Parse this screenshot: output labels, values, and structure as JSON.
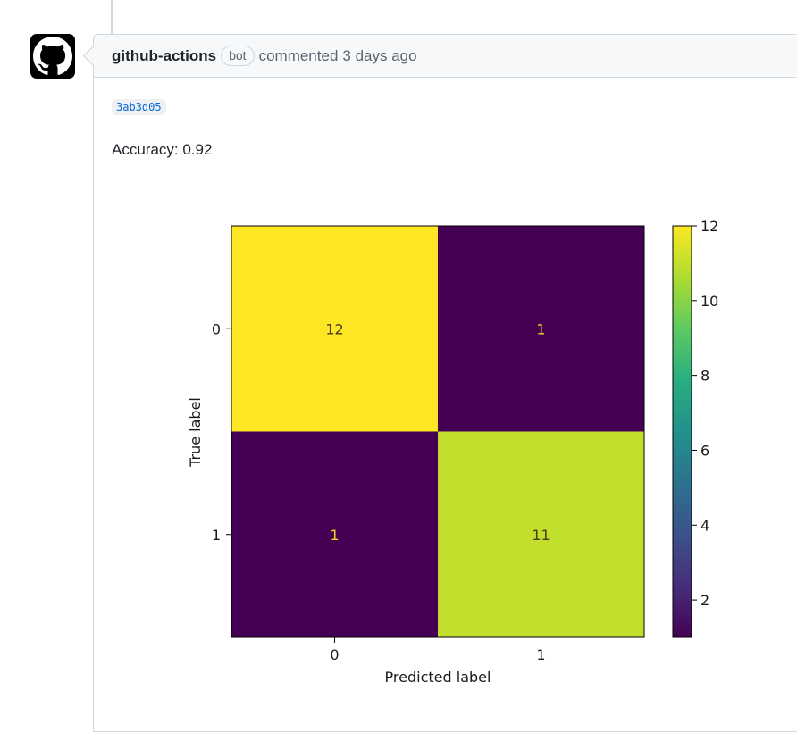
{
  "comment": {
    "author": "github-actions",
    "badge": "bot",
    "action": "commented",
    "time": "3 days ago",
    "commit_sha": "3ab3d05",
    "body_text": "Accuracy: 0.92"
  },
  "icons": {
    "avatar": "github-mark-icon"
  },
  "colors": {
    "avatar_bg": "#000000",
    "link": "#0969da",
    "viridis_max": "#fde725",
    "viridis_high": "#c2df23",
    "viridis_min": "#440154"
  },
  "chart_data": {
    "type": "heatmap",
    "title": "",
    "xlabel": "Predicted label",
    "ylabel": "True label",
    "x_categories": [
      "0",
      "1"
    ],
    "y_categories": [
      "0",
      "1"
    ],
    "values": [
      [
        12,
        1
      ],
      [
        1,
        11
      ]
    ],
    "colormap": "viridis",
    "vmin": 1,
    "vmax": 12,
    "colorbar_ticks": [
      "2",
      "4",
      "6",
      "8",
      "10",
      "12"
    ],
    "colorbar_tick_values": [
      2,
      4,
      6,
      8,
      10,
      12
    ]
  }
}
